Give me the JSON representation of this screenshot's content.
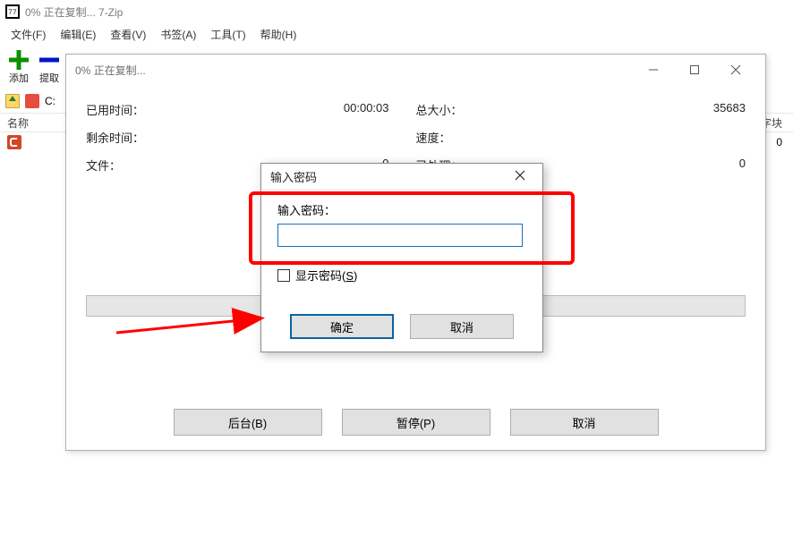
{
  "main": {
    "title": "0% 正在复制... 7-Zip",
    "menu": {
      "file": "文件(F)",
      "edit": "编辑(E)",
      "view": "查看(V)",
      "bookmarks": "书签(A)",
      "tools": "工具(T)",
      "help": "帮助(H)"
    },
    "toolbar": {
      "add": "添加",
      "extract": "提取"
    },
    "addressbar": {
      "path_prefix": "C:"
    },
    "listheader": {
      "name": "名称",
      "block": "字块"
    },
    "listrow": {
      "block_value": "0"
    }
  },
  "progress": {
    "title": "0% 正在复制...",
    "labels": {
      "elapsed": "已用时间：",
      "remaining": "剩余时间：",
      "files": "文件：",
      "total_size": "总大小：",
      "speed": "速度：",
      "processed": "已处理："
    },
    "values": {
      "elapsed": "00:00:03",
      "remaining": "",
      "files": "0",
      "total_size": "35683",
      "speed": "",
      "processed": "0"
    },
    "buttons": {
      "background": "后台(B)",
      "pause": "暂停(P)",
      "cancel": "取消"
    }
  },
  "password": {
    "title": "输入密码",
    "label": "输入密码：",
    "show_password_pre": "显示密码(",
    "show_password_key": "S",
    "show_password_post": ")",
    "ok": "确定",
    "cancel": "取消"
  }
}
